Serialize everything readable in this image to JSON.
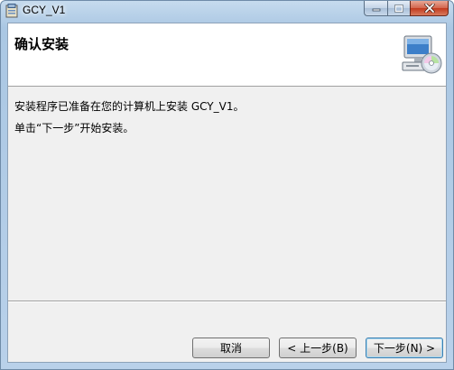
{
  "window": {
    "title": "GCY_V1"
  },
  "banner": {
    "title": "确认安装",
    "icon": "computer-cd-icon"
  },
  "body": {
    "line1": "安装程序已准备在您的计算机上安装 GCY_V1。",
    "line2": "单击“下一步”开始安装。"
  },
  "buttons": {
    "cancel": "取消",
    "back": "< 上一步(B)",
    "next": "下一步(N) >"
  },
  "colors": {
    "titlebar": "#b9d1ea",
    "close_button": "#c2391d",
    "dialog_bg": "#f0f0f0",
    "banner_bg": "#ffffff"
  }
}
